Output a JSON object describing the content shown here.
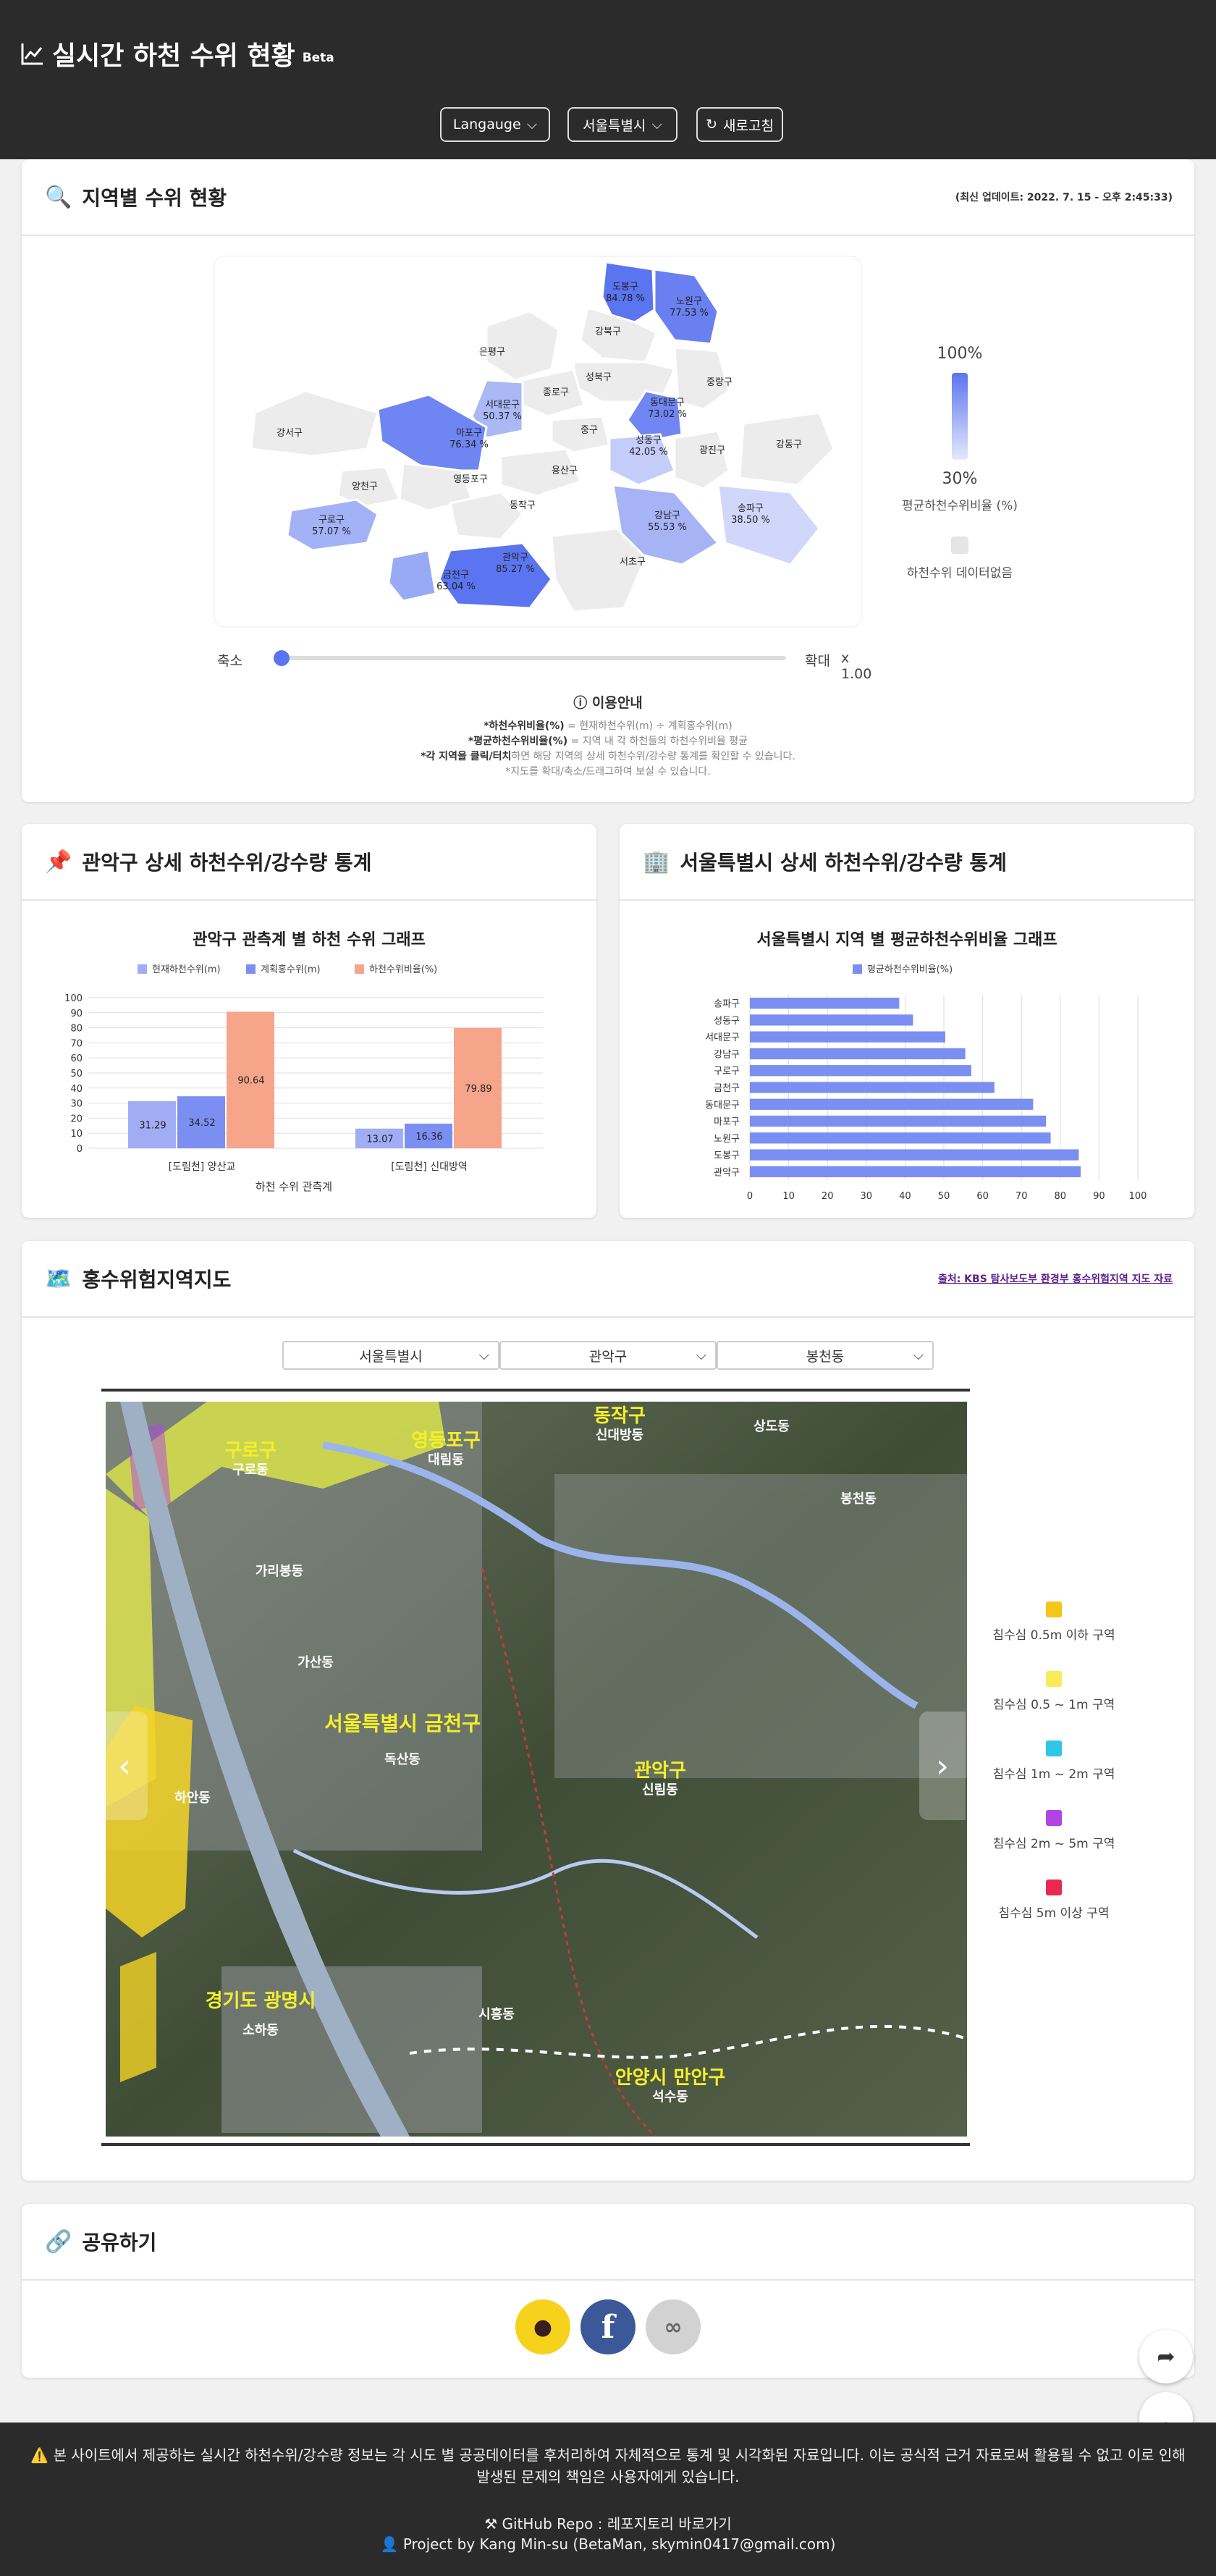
{
  "header": {
    "title": "실시간 하천 수위 현황",
    "beta": "Beta",
    "language_label": "Langauge",
    "region_label": "서울특별시",
    "refresh_label": "새로고침"
  },
  "map_card": {
    "title": "지역별 수위 현황",
    "updated": "(최신 업데이트: 2022. 7. 15 - 오후 2:45:33)",
    "districts": [
      {
        "name": "도봉구",
        "value": "84.78 %"
      },
      {
        "name": "노원구",
        "value": "77.53 %"
      },
      {
        "name": "강북구",
        "value": ""
      },
      {
        "name": "은평구",
        "value": ""
      },
      {
        "name": "성북구",
        "value": ""
      },
      {
        "name": "종로구",
        "value": ""
      },
      {
        "name": "중랑구",
        "value": ""
      },
      {
        "name": "서대문구",
        "value": "50.37 %"
      },
      {
        "name": "동대문구",
        "value": "73.02 %"
      },
      {
        "name": "강서구",
        "value": ""
      },
      {
        "name": "마포구",
        "value": "76.34 %"
      },
      {
        "name": "중구",
        "value": ""
      },
      {
        "name": "성동구",
        "value": "42.05 %"
      },
      {
        "name": "광진구",
        "value": ""
      },
      {
        "name": "강동구",
        "value": ""
      },
      {
        "name": "양천구",
        "value": ""
      },
      {
        "name": "영등포구",
        "value": ""
      },
      {
        "name": "용산구",
        "value": ""
      },
      {
        "name": "구로구",
        "value": "57.07 %"
      },
      {
        "name": "동작구",
        "value": ""
      },
      {
        "name": "강남구",
        "value": "55.53 %"
      },
      {
        "name": "송파구",
        "value": "38.50 %"
      },
      {
        "name": "금천구",
        "value": "63.04 %"
      },
      {
        "name": "관악구",
        "value": "85.27 %"
      },
      {
        "name": "서초구",
        "value": ""
      }
    ],
    "legend_max": "100%",
    "legend_min": "30%",
    "legend_caption": "평균하천수위비율 (%)",
    "no_data_caption": "하천수위 데이터없음",
    "zoom_out": "축소",
    "zoom_in": "확대",
    "zoom_value": "x 1.00",
    "info_title": "이용안내",
    "info_lines": [
      {
        "bold": "*하천수위비율(%)",
        "rest": " = 현재하천수위(m) ÷ 계획홍수위(m)"
      },
      {
        "bold": "*평균하천수위비율(%)",
        "rest": " = 지역 내 각 하천들의 하천수위비율 평균"
      },
      {
        "bold": "*각 지역을 클릭/터치",
        "rest": "하면 해당 지역의 상세 하천수위/강수량 통계를 확인할 수 있습니다."
      },
      {
        "bold": "",
        "rest": "*지도를 확대/축소/드래그하여 보실 수 있습니다."
      }
    ],
    "colors": {
      "high": "#5b74f0",
      "low": "#e4e8fc",
      "nodata": "#ececec"
    }
  },
  "district_stats": {
    "title": "관악구 상세 하천수위/강수량 통계",
    "chart_title": "관악구 관측계 별 하천 수위 그래프",
    "legend": [
      "현재하천수위(m)",
      "계획홍수위(m)",
      "하천수위비율(%)"
    ],
    "xlabel": "하천 수위 관측계"
  },
  "city_stats": {
    "title": "서울특별시 상세 하천수위/강수량 통계",
    "chart_title": "서울특별시 지역 별 평균하천수위비율 그래프",
    "legend": [
      "평균하천수위비율(%)"
    ]
  },
  "chart_data": [
    {
      "type": "bar",
      "categories": [
        "[도림천] 양산교",
        "[도림천] 신대방역"
      ],
      "series": [
        {
          "name": "현재하천수위(m)",
          "values": [
            31.29,
            13.07
          ],
          "color": "#a0adf5"
        },
        {
          "name": "계획홍수위(m)",
          "values": [
            34.52,
            16.36
          ],
          "color": "#7b8ef2"
        },
        {
          "name": "하천수위비율(%)",
          "values": [
            90.64,
            79.89
          ],
          "color": "#f6a58b"
        }
      ],
      "title": "관악구 관측계 별 하천 수위 그래프",
      "xlabel": "하천 수위 관측계",
      "ylabel": "",
      "ylim": [
        0,
        100
      ],
      "yticks": [
        0,
        10,
        20,
        30,
        40,
        50,
        60,
        70,
        80,
        90,
        100
      ],
      "grid": true,
      "legend": "top"
    },
    {
      "type": "bar",
      "orientation": "horizontal",
      "categories": [
        "송파구",
        "성동구",
        "서대문구",
        "강남구",
        "구로구",
        "금천구",
        "동대문구",
        "마포구",
        "노원구",
        "도봉구",
        "관악구"
      ],
      "series": [
        {
          "name": "평균하천수위비율(%)",
          "values": [
            38.5,
            42.05,
            50.37,
            55.53,
            57.07,
            63.04,
            73.02,
            76.34,
            77.53,
            84.78,
            85.27
          ],
          "color": "#7b8ef2"
        }
      ],
      "title": "서울특별시 지역 별 평균하천수위비율 그래프",
      "xlim": [
        0,
        100
      ],
      "xticks": [
        0,
        10,
        20,
        30,
        40,
        50,
        60,
        70,
        80,
        90,
        100
      ],
      "grid": true,
      "legend": "top"
    }
  ],
  "flood_map": {
    "title": "홍수위험지역지도",
    "source": "출처: KBS 탐사보도부 환경부 홍수위험지역 지도 자료",
    "selects": [
      "서울특별시",
      "관악구",
      "봉천동"
    ],
    "place_labels": [
      {
        "text": "구로구",
        "sub": "구로동"
      },
      {
        "text": "영등포구",
        "sub": "대림동"
      },
      {
        "text": "동작구",
        "sub": "신대방동"
      },
      {
        "text": "",
        "sub": "상도동"
      },
      {
        "text": "",
        "sub": "봉천동"
      },
      {
        "text": "",
        "sub": "가리봉동"
      },
      {
        "text": "",
        "sub": "가산동"
      },
      {
        "text": "서울특별시 금천구",
        "sub": "독산동"
      },
      {
        "text": "관악구",
        "sub": "신림동"
      },
      {
        "text": "",
        "sub": "하안동"
      },
      {
        "text": "경기도 광명시",
        "sub": "소하동"
      },
      {
        "text": "",
        "sub": "시흥동"
      },
      {
        "text": "안양시 만안구",
        "sub": "석수동"
      }
    ],
    "legend": [
      {
        "label": "침수심 0.5m 이하 구역",
        "color": "#f5c518"
      },
      {
        "label": "침수심 0.5 ~ 1m 구역",
        "color": "#f7ec5a"
      },
      {
        "label": "침수심 1m ~ 2m 구역",
        "color": "#2ec7e6"
      },
      {
        "label": "침수심 2m ~ 5m 구역",
        "color": "#b044e6"
      },
      {
        "label": "침수심 5m 이상 구역",
        "color": "#e8294f"
      }
    ]
  },
  "share": {
    "title": "공유하기"
  },
  "footer": {
    "notice": "본 사이트에서 제공하는 실시간 하천수위/강수량 정보는 각 시도 별 공공데이터를 후처리하여 자체적으로 통계 및 시각화된 자료입니다. 이는 공식적 근거 자료로써 활용될 수 없고 이로 인해 발생된 문제의 책임은 사용자에게 있습니다.",
    "repo_label": "GitHub Repo : ",
    "repo_link": "레포지토리 바로가기",
    "credit": "Project by Kang Min-su (BetaMan, skymin0417@gmail.com)"
  }
}
